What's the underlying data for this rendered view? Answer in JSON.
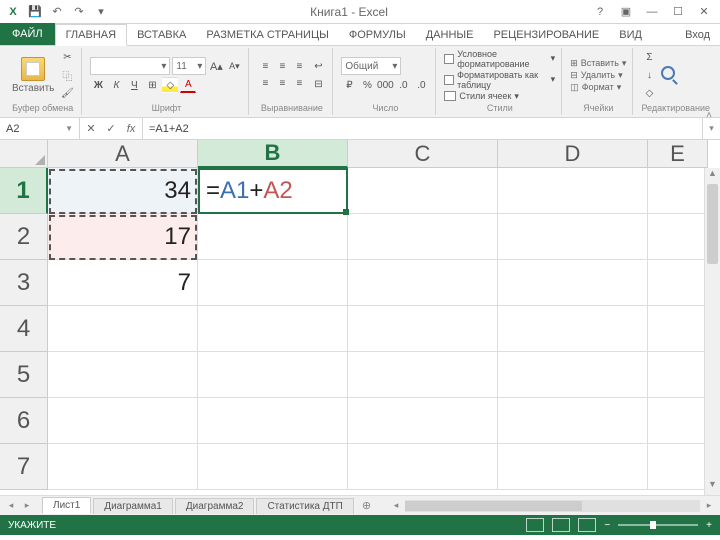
{
  "title": "Книга1 - Excel",
  "qat": {
    "save": "💾",
    "undo": "↶",
    "redo": "↷"
  },
  "tabs": {
    "file": "ФАЙЛ",
    "items": [
      "ГЛАВНАЯ",
      "ВСТАВКА",
      "РАЗМЕТКА СТРАНИЦЫ",
      "ФОРМУЛЫ",
      "ДАННЫЕ",
      "РЕЦЕНЗИРОВАНИЕ",
      "ВИД"
    ],
    "active": 0,
    "signin": "Вход"
  },
  "ribbon": {
    "clipboard": {
      "paste": "Вставить",
      "label": "Буфер обмена"
    },
    "font": {
      "name": "",
      "size": "11",
      "label": "Шрифт",
      "bold": "Ж",
      "italic": "К",
      "underline": "Ч",
      "increase": "A",
      "decrease": "A"
    },
    "alignment": {
      "label": "Выравнивание"
    },
    "number": {
      "format": "Общий",
      "label": "Число",
      "percent": "%",
      "thousands": "000"
    },
    "styles": {
      "conditional": "Условное форматирование",
      "table": "Форматировать как таблицу",
      "cell": "Стили ячеек",
      "label": "Стили"
    },
    "cells": {
      "insert": "Вставить",
      "delete": "Удалить",
      "format": "Формат",
      "label": "Ячейки"
    },
    "editing": {
      "label": "Редактирование"
    }
  },
  "formulabar": {
    "namebox": "A2",
    "cancel": "✕",
    "enter": "✓",
    "fx": "fx",
    "formula_raw": "=A1+A2",
    "formula_parts": {
      "eq": "=",
      "ref1": "A1",
      "plus": "+",
      "ref2": "A2"
    }
  },
  "grid": {
    "columns": [
      "A",
      "B",
      "C",
      "D",
      "E"
    ],
    "active_col": 1,
    "rows": [
      1,
      2,
      3,
      4,
      5,
      6,
      7
    ],
    "active_row": 0,
    "cells": {
      "A1": "34",
      "A2": "17",
      "A3": "7",
      "B1_formula": {
        "eq": "=",
        "ref1": "A1",
        "plus": "+",
        "ref2": "A2"
      }
    }
  },
  "sheets": {
    "tabs": [
      "Лист1",
      "Диаграмма1",
      "Диаграмма2",
      "Статистика ДТП"
    ],
    "active": 0
  },
  "status": {
    "mode": "УКАЖИТЕ",
    "zoom": ""
  },
  "chart_data": {
    "type": "table",
    "columns": [
      "A",
      "B"
    ],
    "rows": [
      {
        "A": 34,
        "B": "=A1+A2"
      },
      {
        "A": 17,
        "B": ""
      },
      {
        "A": 7,
        "B": ""
      }
    ]
  }
}
